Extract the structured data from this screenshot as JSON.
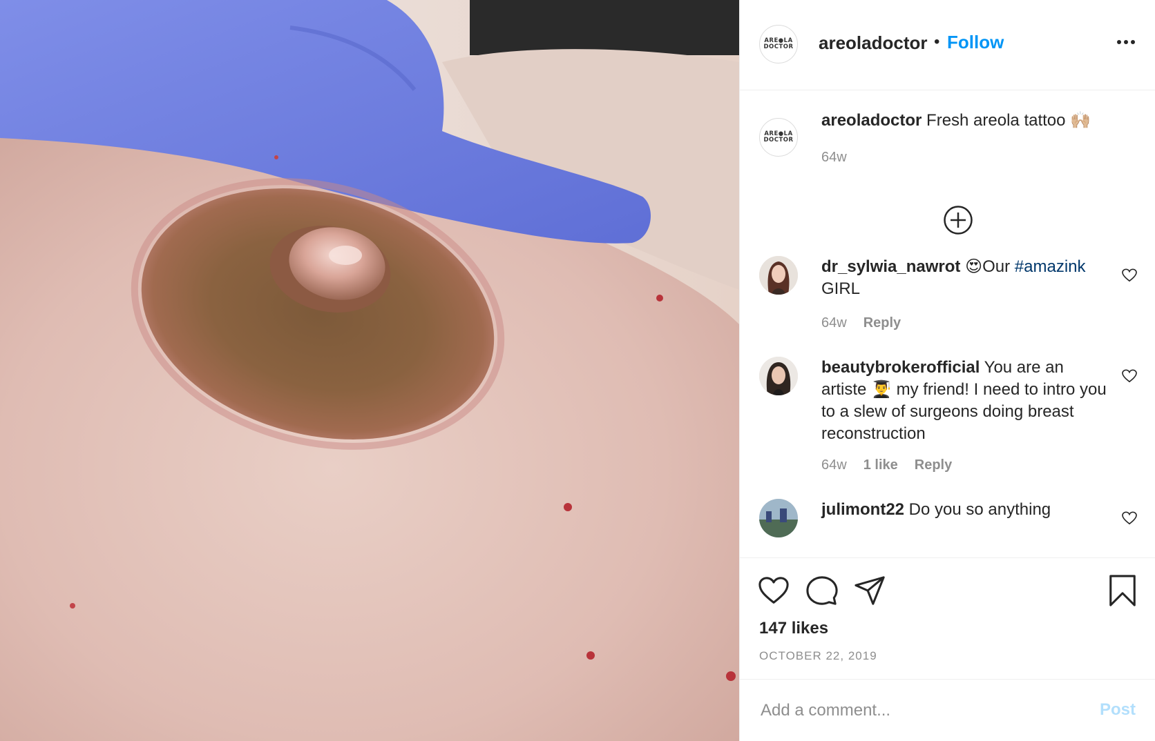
{
  "header": {
    "username": "areoladoctor",
    "separator": "•",
    "follow_label": "Follow",
    "avatar_logo_top": "ARE●LA",
    "avatar_logo_bottom": "DOCTOR"
  },
  "caption": {
    "username": "areoladoctor",
    "text": " Fresh areola tattoo 🙌🏼",
    "time": "64w"
  },
  "comments": [
    {
      "username": "dr_sylwia_nawrot",
      "text_before": " 😍Our ",
      "hashtag": "#amazink",
      "text_after": " GIRL",
      "time": "64w",
      "likes": "",
      "reply_label": "Reply"
    },
    {
      "username": "beautybrokerofficial",
      "text": " You are an artiste 👨‍🎓 my friend! I need to intro you to a slew of surgeons doing breast reconstruction",
      "time": "64w",
      "likes": "1 like",
      "reply_label": "Reply"
    },
    {
      "username": "julimont22",
      "text": " Do you so anything"
    }
  ],
  "actions": {
    "likes": "147 likes",
    "date": "OCTOBER 22, 2019"
  },
  "comment_box": {
    "placeholder": "Add a comment...",
    "post_label": "Post"
  },
  "colors": {
    "link_blue": "#0095f6",
    "hashtag": "#00376b",
    "muted": "#8e8e8e",
    "post_disabled": "#b2dffc"
  }
}
